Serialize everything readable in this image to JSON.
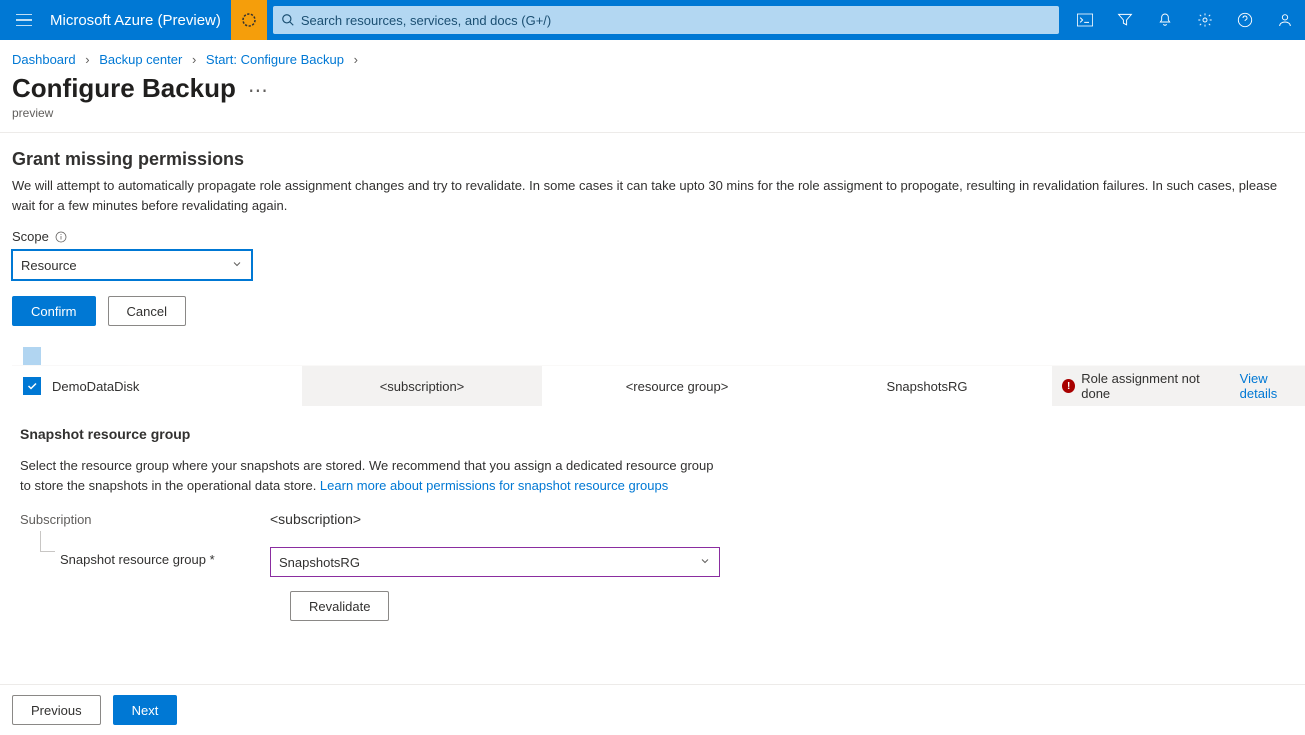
{
  "header": {
    "brand": "Microsoft Azure (Preview)",
    "search_placeholder": "Search resources, services, and docs (G+/)"
  },
  "breadcrumbs": {
    "items": [
      "Dashboard",
      "Backup center",
      "Start: Configure Backup"
    ]
  },
  "page": {
    "title": "Configure Backup",
    "subtitle": "preview"
  },
  "grant": {
    "heading": "Grant missing permissions",
    "description": "We will attempt to automatically propagate role assignment changes and try to revalidate. In some cases it can take upto 30 mins for the role assigment to propogate, resulting in revalidation failures. In such cases, please wait for a few minutes before revalidating again.",
    "scope_label": "Scope",
    "scope_value": "Resource",
    "confirm": "Confirm",
    "cancel": "Cancel"
  },
  "table": {
    "row": {
      "name": "DemoDataDisk",
      "subscription": "<subscription>",
      "resource_group": "<resource group>",
      "snapshot_rg": "SnapshotsRG",
      "status": "Role assignment not done",
      "details_link": "View details"
    }
  },
  "snapshot": {
    "heading": "Snapshot resource group",
    "description_1": "Select the resource group where your snapshots are stored. We recommend that you assign a dedicated resource group to store the snapshots in the operational data store. ",
    "learn_link": "Learn more about permissions for snapshot resource groups",
    "subscription_label": "Subscription",
    "subscription_value": "<subscription>",
    "rg_label": "Snapshot resource group *",
    "rg_value": "SnapshotsRG",
    "revalidate": "Revalidate"
  },
  "footer": {
    "previous": "Previous",
    "next": "Next"
  }
}
